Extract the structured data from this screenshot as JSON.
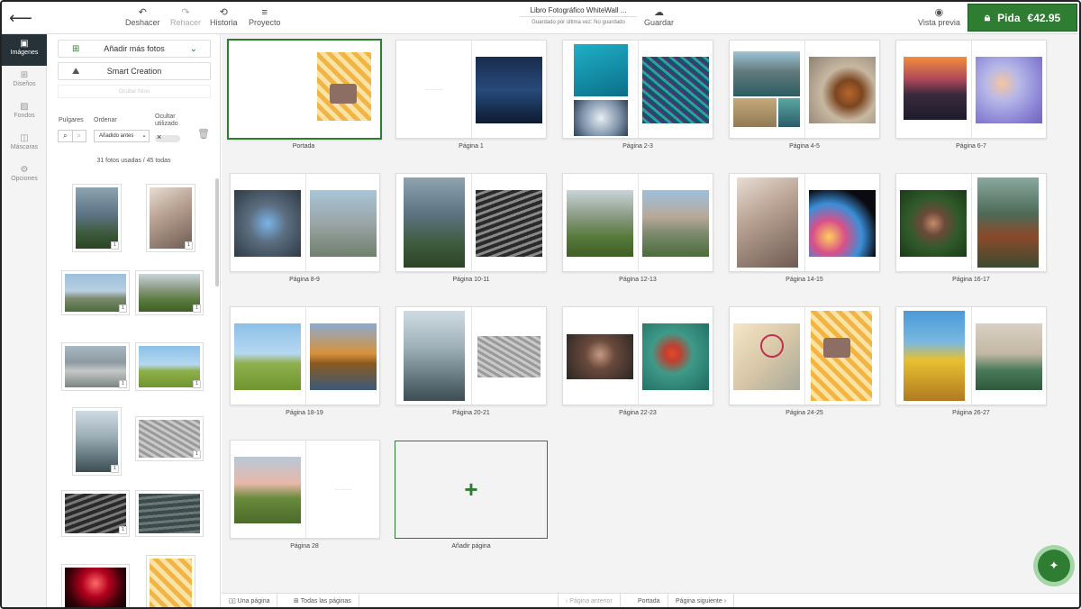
{
  "header": {
    "back_icon": "arrow-left-icon",
    "tools": [
      {
        "label": "Deshacer",
        "icon": "↶",
        "disabled": false
      },
      {
        "label": "Rehacer",
        "icon": "↷",
        "disabled": true
      },
      {
        "label": "Historia",
        "icon": "⟲",
        "disabled": false
      },
      {
        "label": "Proyecto",
        "icon": "≡",
        "disabled": false
      }
    ],
    "doc_title": "Libro Fotográfico WhiteWall ...",
    "doc_status": "Guardado por última vez: No guardado",
    "save_label": "Guardar",
    "preview_label": "Vista previa",
    "order_label": "Pida",
    "order_price": "€42.95"
  },
  "rail": {
    "items": [
      {
        "label": "Imágenes",
        "icon": "▣",
        "active": true
      },
      {
        "label": "Diseños",
        "icon": "⊞",
        "active": false
      },
      {
        "label": "Fondos",
        "icon": "▨",
        "active": false
      },
      {
        "label": "Máscaras",
        "icon": "◫",
        "active": false
      },
      {
        "label": "Opciones",
        "icon": "⚙",
        "active": false
      }
    ]
  },
  "panel": {
    "add_photos_label": "Añadir más fotos",
    "smart_creation_label": "Smart Creation",
    "ghost_label": "Ocultar fotos",
    "thumbs_label": "Pulgares",
    "sort_label": "Ordenar",
    "sort_value": "Añadido antes",
    "hide_used_label": "Ocultar utilizado",
    "count_text": "31 fotos usadas / 45 todas",
    "badge": "1"
  },
  "pages": [
    {
      "label": "Portada"
    },
    {
      "label": "Página 1"
    },
    {
      "label": "Página 2-3"
    },
    {
      "label": "Página 4-5"
    },
    {
      "label": "Página 6-7"
    },
    {
      "label": "Página 8-9"
    },
    {
      "label": "Página 10-11"
    },
    {
      "label": "Página 12-13"
    },
    {
      "label": "Página 14-15"
    },
    {
      "label": "Página 16-17"
    },
    {
      "label": "Página 18-19"
    },
    {
      "label": "Página 20-21"
    },
    {
      "label": "Página 22-23"
    },
    {
      "label": "Página 24-25"
    },
    {
      "label": "Página 26-27"
    },
    {
      "label": "Página 28"
    },
    {
      "label": "Añadir página"
    }
  ],
  "bottom": {
    "one_page": "Una página",
    "all_pages": "Todas las páginas",
    "prev": "Página anterior",
    "cover": "Portada",
    "next": "Página siguiente"
  },
  "colors": {
    "accent": "#2e7d32"
  }
}
